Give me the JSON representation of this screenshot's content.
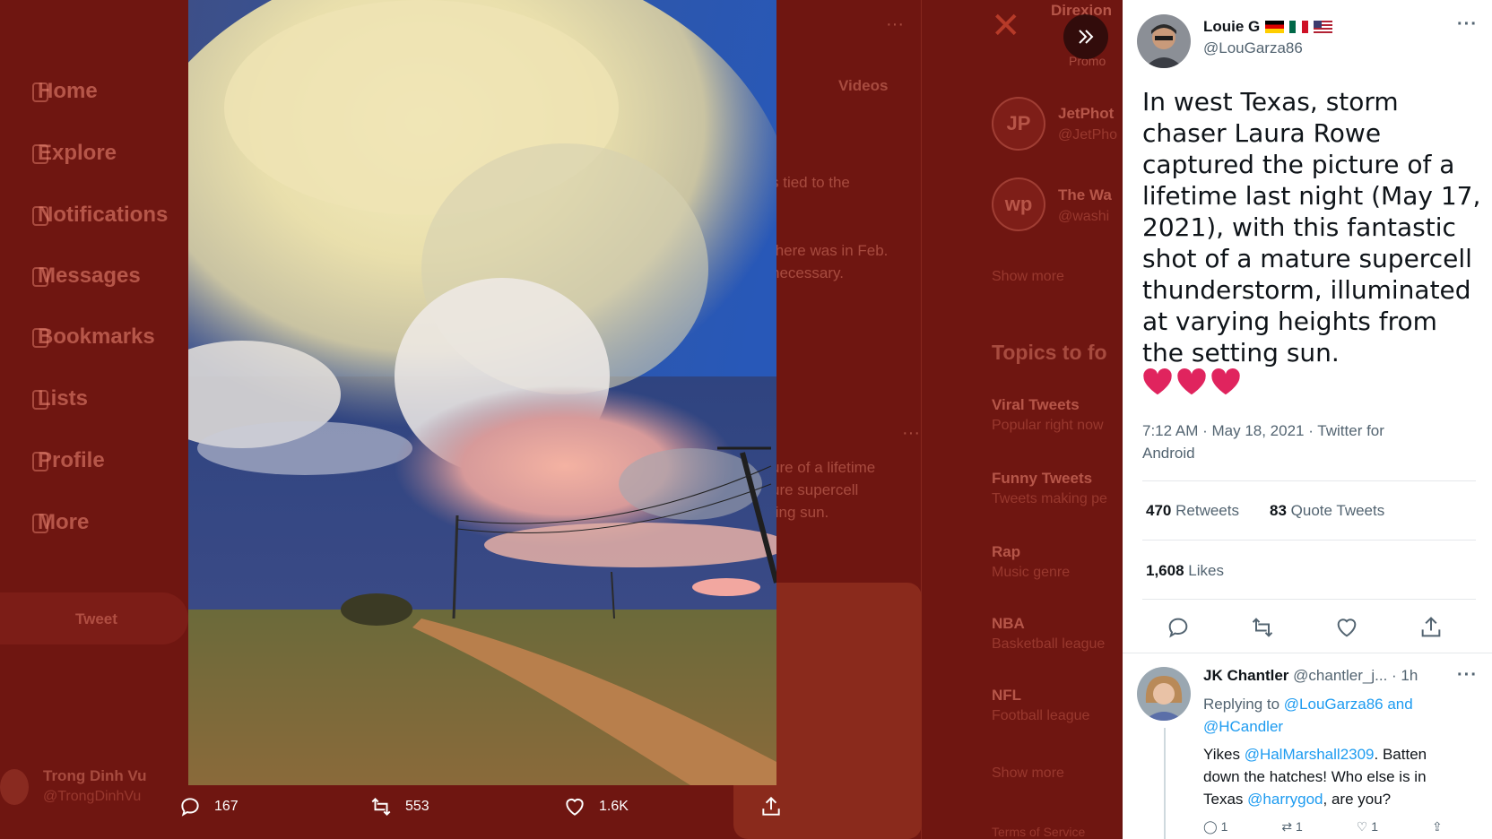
{
  "background": {
    "nav": [
      "Home",
      "Explore",
      "Notifications",
      "Messages",
      "Bookmarks",
      "Lists",
      "Profile",
      "More"
    ],
    "tweet_button": "Tweet",
    "account_name": "Trong Dinh Vu",
    "account_handle": "@TrongDinhVu",
    "middle_fragments": [
      "Videos",
      "s tied to the",
      "there was in Feb.",
      "necessary.",
      "ure of a lifetime",
      "ure supercell",
      "ting sun."
    ],
    "right_col": {
      "promo_title": "Direxion",
      "promo_label": "Promo",
      "who_to_follow": [
        {
          "name": "JetPhot",
          "handle": "@JetPho",
          "avatar": "JP"
        },
        {
          "name": "The Wa",
          "handle": "@washi",
          "avatar": "wp"
        }
      ],
      "show_more": "Show more",
      "topics_heading": "Topics to fo",
      "topics": [
        {
          "name": "Viral Tweets",
          "desc": "Popular right now"
        },
        {
          "name": "Funny Tweets",
          "desc": "Tweets making pe"
        },
        {
          "name": "Rap",
          "desc": "Music genre"
        },
        {
          "name": "NBA",
          "desc": "Basketball league"
        },
        {
          "name": "NFL",
          "desc": "Football league"
        }
      ],
      "show_more_2": "Show more",
      "footer": "Terms of Service"
    }
  },
  "media_bar": {
    "replies": "167",
    "retweets": "553",
    "likes": "1.6K"
  },
  "tweet": {
    "author_name": "Louie G",
    "flags": [
      "germany-flag",
      "mexico-flag",
      "usa-flag"
    ],
    "author_handle": "@LouGarza86",
    "text": "In west Texas, storm chaser Laura Rowe captured the picture of a lifetime last night (May 17, 2021), with this fantastic shot of a mature supercell thunderstorm, illuminated at varying heights from the setting sun.",
    "hearts": [
      "heart-emoji",
      "heart-emoji",
      "heart-emoji"
    ],
    "timestamp": "7:12 AM · May 18, 2021 · Twitter for Android",
    "retweets_count": "470",
    "retweets_label": "Retweets",
    "quote_count": "83",
    "quote_label": "Quote Tweets",
    "likes_count": "1,608",
    "likes_label": "Likes"
  },
  "reply": {
    "name": "JK Chantler",
    "handle": "@chantler_j...",
    "time": "· 1h",
    "replying_prefix": "Replying to",
    "replying_to": "@LouGarza86 and @HCandler",
    "text_1": "Yikes",
    "mention_1": "@HalMarshall2309",
    "text_2": ". Batten down the hatches! Who else is in Texas",
    "mention_2": "@harrygod",
    "text_3": ", are you?",
    "reply_count": "1",
    "retweet_count": "1",
    "like_count": "1"
  },
  "colors": {
    "accent": "#1d9bf0",
    "heart": "#e0245e",
    "overlay": "#6f1611"
  }
}
